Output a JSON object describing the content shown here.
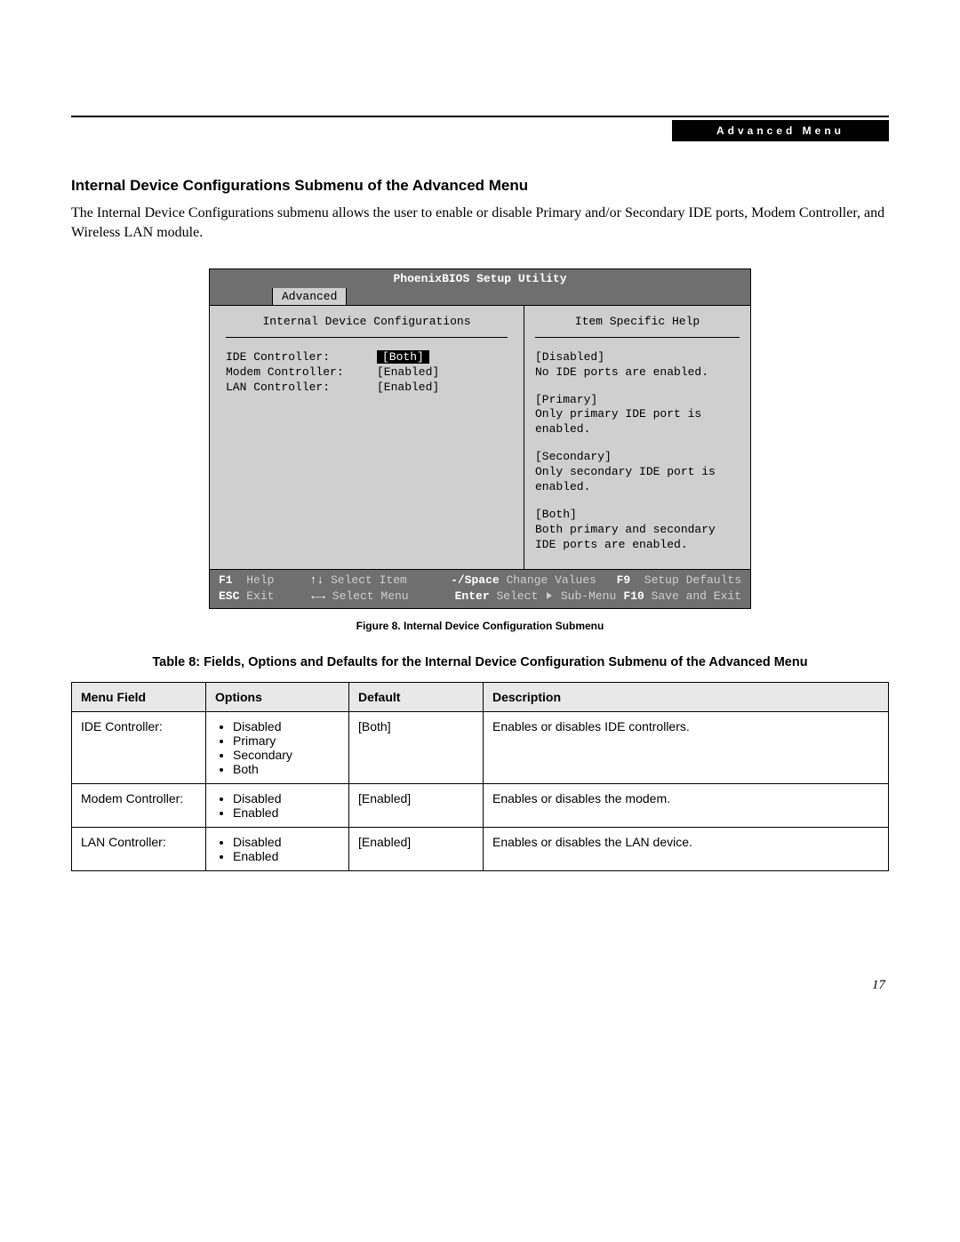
{
  "header": {
    "chip": "Advanced Menu"
  },
  "section": {
    "heading": "Internal Device Configurations Submenu of the Advanced Menu",
    "paragraph": "The Internal Device Configurations submenu allows the user to enable or disable Primary and/or Secondary IDE ports, Modem Controller, and Wireless LAN module."
  },
  "bios": {
    "title": "PhoenixBIOS Setup Utility",
    "tab": "Advanced",
    "panel_title_left": "Internal Device Configurations",
    "panel_title_right": "Item Specific Help",
    "rows": [
      {
        "label": "IDE Controller:",
        "value": "[Both]",
        "selected": true
      },
      {
        "label": "Modem Controller:",
        "value": "[Enabled]",
        "selected": false
      },
      {
        "label": "LAN Controller:",
        "value": "[Enabled]",
        "selected": false
      }
    ],
    "help": [
      {
        "tag": "[Disabled]",
        "text": "No IDE ports are enabled."
      },
      {
        "tag": "[Primary]",
        "text": "Only primary IDE port is enabled."
      },
      {
        "tag": "[Secondary]",
        "text": "Only secondary IDE port is enabled."
      },
      {
        "tag": "[Both]",
        "text": "Both primary and secondary IDE ports are enabled."
      }
    ],
    "footer": {
      "r1": {
        "k1": "F1",
        "d1": "Help",
        "k2": "↑↓",
        "d2": "Select Item",
        "k3": "-/Space",
        "d3": "Change Values",
        "k4": "F9",
        "d4": "Setup Defaults"
      },
      "r2": {
        "k1": "ESC",
        "d1": "Exit",
        "k2": "←→",
        "d2": "Select Menu",
        "k3": "Enter",
        "d3": "Select ▶ Sub-Menu",
        "k4": "F10",
        "d4": "Save and Exit"
      }
    }
  },
  "figure_caption": "Figure 8.  Internal Device Configuration Submenu",
  "table_caption": "Table 8: Fields, Options and Defaults for the Internal Device Configuration Submenu of the Advanced Menu",
  "table": {
    "headers": {
      "menu_field": "Menu Field",
      "options": "Options",
      "default": "Default",
      "description": "Description"
    },
    "rows": [
      {
        "menu_field": "IDE Controller:",
        "options": [
          "Disabled",
          "Primary",
          "Secondary",
          "Both"
        ],
        "default": "[Both]",
        "description": "Enables or disables IDE controllers."
      },
      {
        "menu_field": "Modem Controller:",
        "options": [
          "Disabled",
          "Enabled"
        ],
        "default": "[Enabled]",
        "description": "Enables or disables the modem."
      },
      {
        "menu_field": "LAN Controller:",
        "options": [
          "Disabled",
          "Enabled"
        ],
        "default": "[Enabled]",
        "description": "Enables or disables the LAN device."
      }
    ]
  },
  "page_number": "17"
}
